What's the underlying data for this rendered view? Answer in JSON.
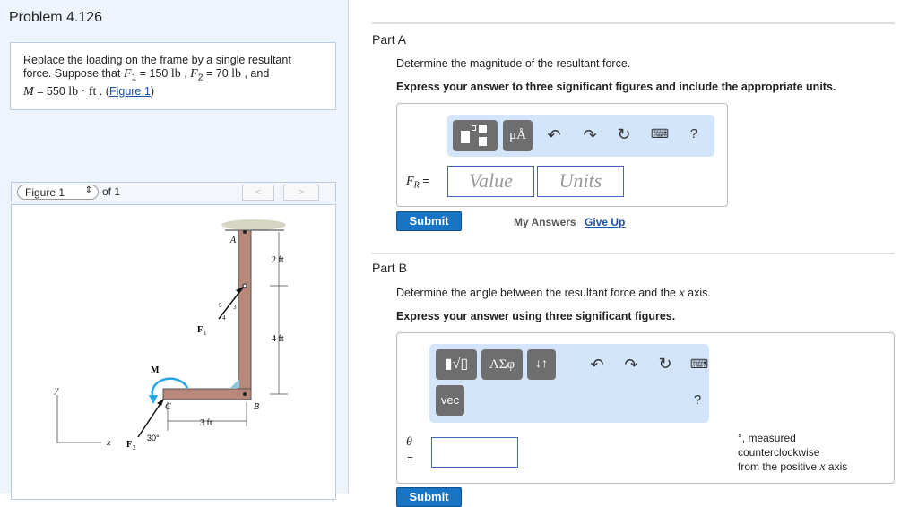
{
  "problem": {
    "title": "Problem 4.126",
    "text1": "Replace the loading on the frame by a single resultant",
    "text2a": "force. Suppose that ",
    "F1": "F",
    "F1sub": "1",
    "eq1": " = 150 ",
    "lb": "lb",
    "sep1": " , ",
    "F2": "F",
    "F2sub": "2",
    "eq2": " = 70 ",
    "sep2": " , and",
    "M": "M",
    "eq3": " = 550 ",
    "lbft": "lb · ft",
    "sep3": " . (",
    "figlink": "Figure 1",
    "close": ")"
  },
  "figure_nav": {
    "select": "Figure 1",
    "of": "of 1",
    "prev": "<",
    "next": ">"
  },
  "figure": {
    "A": "A",
    "B": "B",
    "C": "C",
    "d1": "2 ft",
    "d2": "4 ft",
    "d3": "3 ft",
    "F1": "F",
    "F2": "F",
    "M": "M",
    "x": "x",
    "y": "y",
    "angle": "30°",
    "s5": "5",
    "s3": "3",
    "s4": "4",
    "sub1": "1",
    "sub2": "2"
  },
  "partA": {
    "label": "Part A",
    "question": "Determine the magnitude of the resultant force.",
    "instruction": "Express your answer to three significant figures and include the appropriate units.",
    "var": "F",
    "varsub": "R",
    "eq": " =",
    "value_placeholder": "Value",
    "units_placeholder": "Units",
    "units_btn": "μÅ",
    "help": "?",
    "submit": "Submit",
    "my_answers": "My Answers",
    "give_up": "Give Up"
  },
  "partB": {
    "label": "Part B",
    "question_pre": "Determine the angle between the resultant force and the ",
    "question_x": "x",
    "question_post": " axis.",
    "instruction": "Express your answer using three significant figures.",
    "greek_btn": "ΑΣφ",
    "sort_btn": "↓↑",
    "vec_btn": "vec",
    "help": "?",
    "var": "θ",
    "eq": "=",
    "suffix1": "°, measured",
    "suffix2": "counterclockwise",
    "suffix3_pre": "from the positive ",
    "suffix3_x": "x",
    "suffix3_post": " axis",
    "submit": "Submit"
  },
  "colors": {
    "accent": "#1a74c4",
    "toolbar": "#d3e5fa",
    "panel": "#eef4fb",
    "moment": "#29a8e0",
    "wood": "#b8887a"
  }
}
